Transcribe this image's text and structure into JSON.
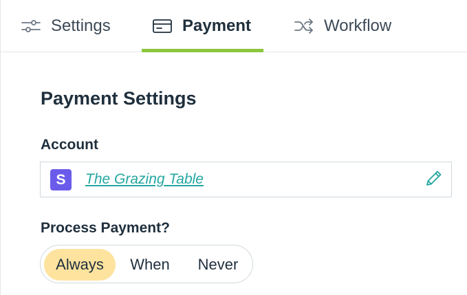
{
  "tabs": {
    "settings": {
      "label": "Settings",
      "icon": "sliders-icon"
    },
    "payment": {
      "label": "Payment",
      "icon": "credit-card-icon",
      "active": true
    },
    "workflow": {
      "label": "Workflow",
      "icon": "shuffle-icon"
    }
  },
  "section": {
    "title": "Payment Settings"
  },
  "account": {
    "label": "Account",
    "provider_letter": "S",
    "name": "The Grazing Table",
    "edit_icon": "pencil-icon"
  },
  "process_payment": {
    "label": "Process Payment?",
    "options": [
      "Always",
      "When",
      "Never"
    ],
    "selected": "Always"
  },
  "colors": {
    "accent_underline": "#8cc63e",
    "link": "#23a6a1",
    "selected_option": "#fde39e",
    "provider_logo": "#6b5bea"
  }
}
